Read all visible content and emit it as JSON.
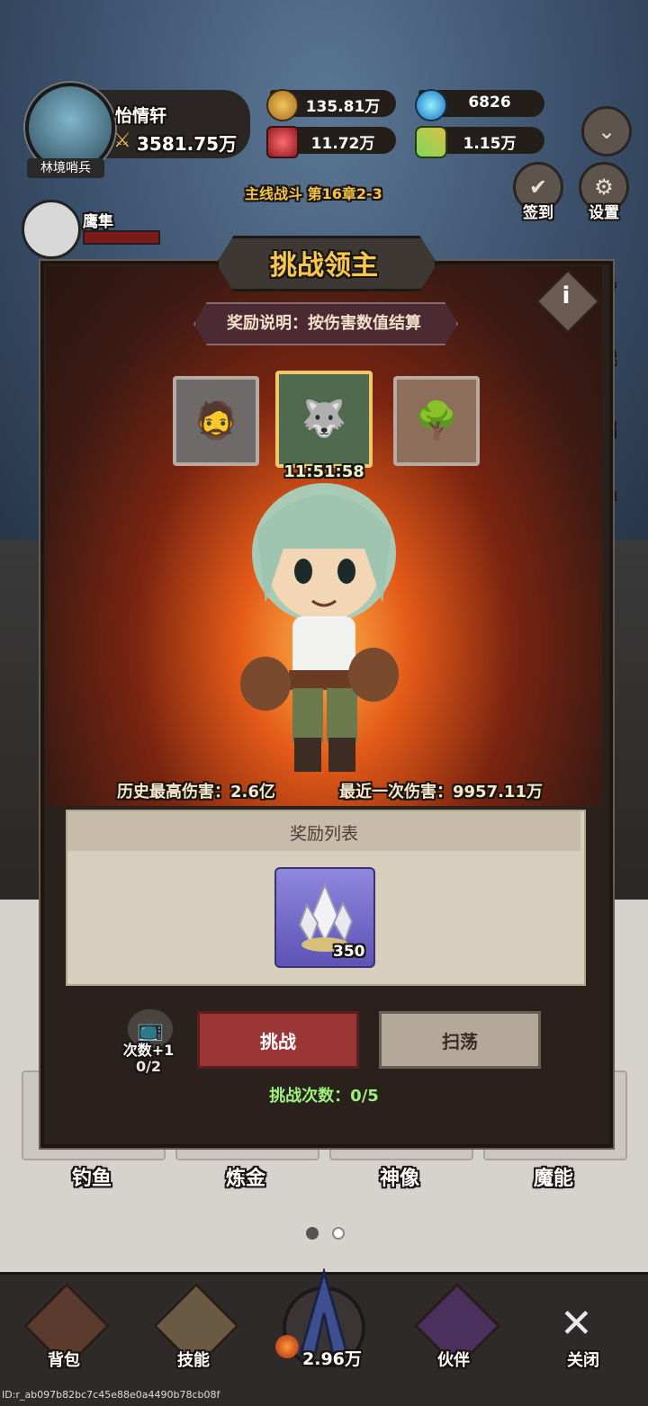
{
  "player": {
    "name": "怡情轩",
    "power": "3581.75万",
    "title_badge": "林境哨兵"
  },
  "resources": [
    {
      "icon": "gold-coin-icon",
      "value": "135.81万"
    },
    {
      "icon": "blue-orb-icon",
      "value": "6826"
    },
    {
      "icon": "red-gem-icon",
      "value": "11.72万"
    },
    {
      "icon": "green-ticket-icon",
      "value": "1.15万"
    }
  ],
  "side_menu": {
    "signin": "签到",
    "settings": "设置",
    "partial_labels": [
      "务",
      "就",
      "福",
      "行"
    ]
  },
  "pet": {
    "name": "鹰隼"
  },
  "stage": {
    "label": "主线战斗 第16章2-3"
  },
  "modal": {
    "title": "挑战领主",
    "info": "i",
    "reward_desc": "奖励说明：按伤害数值结算",
    "timer": "11:51:58",
    "best_damage": "历史最高伤害：2.6亿",
    "last_damage": "最近一次伤害：9957.11万",
    "reward_list_title": "奖励列表",
    "reward_item": {
      "icon": "crystal-icon",
      "count": "350"
    },
    "extra_attempt_label": "次数+1",
    "extra_attempt_count": "0/2",
    "challenge_button": "挑战",
    "sweep_button": "扫荡",
    "attempts": "挑战次数：0/5"
  },
  "grid": [
    "钓鱼",
    "炼金",
    "神像",
    "魔能"
  ],
  "bottom_nav": {
    "bag": "背包",
    "skills": "技能",
    "center_value": "2.96万",
    "partner": "伙伴",
    "close": "关闭"
  },
  "footer_id": "ID:r_ab097b82bc7c45e88e0a4490b78cb08f",
  "colors": {
    "gold": "#f6c94e",
    "attempts_green": "#9df27d",
    "challenge_red": "#9a3636"
  }
}
